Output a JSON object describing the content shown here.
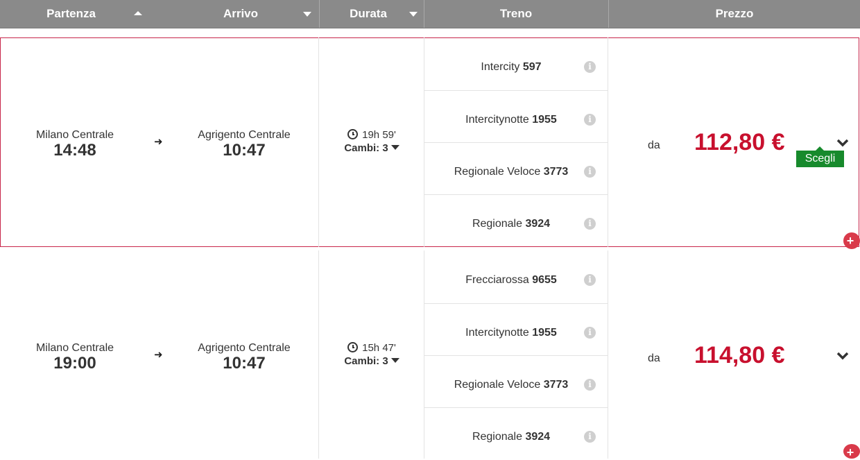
{
  "header": {
    "partenza": "Partenza",
    "arrivo": "Arrivo",
    "durata": "Durata",
    "treno": "Treno",
    "prezzo": "Prezzo"
  },
  "solutions": [
    {
      "from": "Milano Centrale",
      "dep_time": "14:48",
      "to": "Agrigento Centrale",
      "arr_time": "10:47",
      "duration": "19h 59'",
      "changes": "Cambi: 3",
      "trains": [
        {
          "type": "Intercity",
          "number": "597"
        },
        {
          "type": "Intercitynotte",
          "number": "1955"
        },
        {
          "type": "Regionale Veloce",
          "number": "3773"
        },
        {
          "type": "Regionale",
          "number": "3924"
        }
      ],
      "price_prefix": "da",
      "price": "112,80 €",
      "choose_label": "Scegli"
    },
    {
      "from": "Milano Centrale",
      "dep_time": "19:00",
      "to": "Agrigento Centrale",
      "arr_time": "10:47",
      "duration": "15h 47'",
      "changes": "Cambi: 3",
      "trains": [
        {
          "type": "Frecciarossa",
          "number": "9655"
        },
        {
          "type": "Intercitynotte",
          "number": "1955"
        },
        {
          "type": "Regionale Veloce",
          "number": "3773"
        },
        {
          "type": "Regionale",
          "number": "3924"
        }
      ],
      "price_prefix": "da",
      "price": "114,80 €"
    }
  ],
  "icons": {
    "info": "i",
    "arrow": "➜",
    "plus": "+"
  },
  "colors": {
    "header_bg": "#8a8a8a",
    "price": "#c8102e",
    "selected_border": "#c8254a",
    "choose_button": "#178a2c"
  }
}
